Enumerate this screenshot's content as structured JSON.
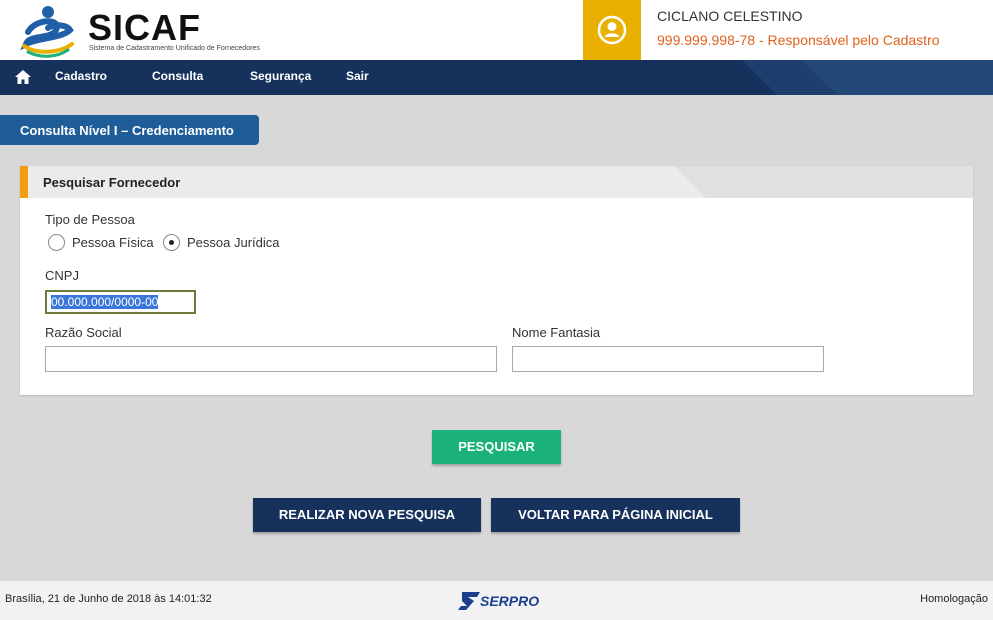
{
  "app": {
    "logo_title": "SICAF",
    "logo_subtitle": "Sistema de Cadastramento Unificado de Fornecedores"
  },
  "user": {
    "name": "CICLANO CELESTINO",
    "role": "999.999.998-78 - Responsável pelo Cadastro",
    "icon": "user-circle-icon",
    "accent_color": "#e9b000"
  },
  "nav": {
    "home_icon": "home-icon",
    "items": [
      {
        "label": "Cadastro"
      },
      {
        "label": "Consulta"
      },
      {
        "label": "Segurança"
      },
      {
        "label": "Sair"
      }
    ]
  },
  "page": {
    "title": "Consulta Nível I – Credenciamento"
  },
  "panel": {
    "title": "Pesquisar Fornecedor",
    "tipo_pessoa": {
      "label": "Tipo de Pessoa",
      "options": [
        {
          "label": "Pessoa Física",
          "selected": false
        },
        {
          "label": "Pessoa Jurídica",
          "selected": true
        }
      ]
    },
    "cnpj": {
      "label": "CNPJ",
      "value": "00.000.000/0000-00"
    },
    "razao_social": {
      "label": "Razão Social",
      "value": ""
    },
    "nome_fantasia": {
      "label": "Nome Fantasia",
      "value": ""
    }
  },
  "actions": {
    "search": "PESQUISAR",
    "new_search": "REALIZAR NOVA PESQUISA",
    "back_home": "VOLTAR PARA PÁGINA INICIAL"
  },
  "footer": {
    "date": "Brasília, 21 de Junho de 2018 às 14:01:32",
    "brand": "SERPRO",
    "environment": "Homologação"
  },
  "colors": {
    "navy": "#16325c",
    "blue_tab": "#1f5d98",
    "green_button": "#1ab27a",
    "orange_accent": "#f39c12",
    "role_text": "#e0621b"
  }
}
